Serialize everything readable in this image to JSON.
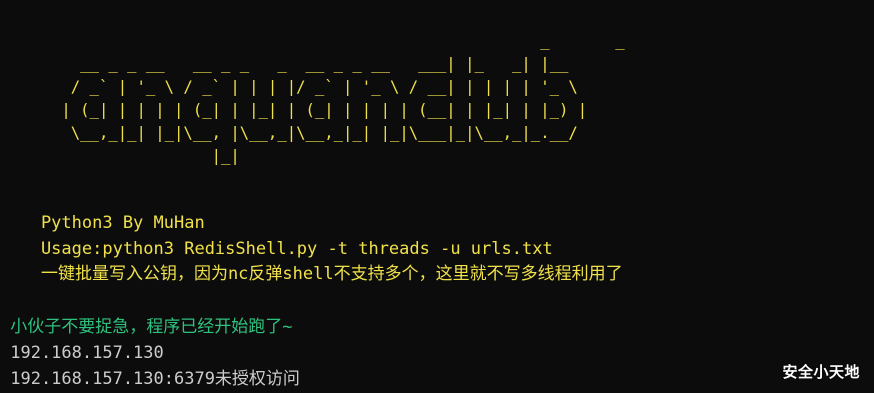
{
  "banner": {
    "art": "                                                    _       _\n   __ _ _ __   __ _ _   _  __ _ _ __   ___| |_   _| |__\n  / _` | '_ \\ / _` | | | |/ _` | '_ \\ / __| | | | | '_ \\\n | (_| | | | | (_| | |_| | (_| | | | | (__| | |_| | |_) |\n  \\__,_|_| |_|\\__, |\\__,_|\\__,_|_| |_|\\___|_|\\__,_|_.__/\n                 |_|"
  },
  "info": {
    "author": "    Python3 By MuHan",
    "usage": "    Usage:python3 RedisShell.py -t threads -u urls.txt",
    "note": "    一键批量写入公钥，因为nc反弹shell不支持多个，这里就不写多线程利用了"
  },
  "output": {
    "status": " 小伙子不要捉急，程序已经开始跑了~",
    "lines": [
      " 192.168.157.130",
      " 192.168.157.130:6379未授权访问"
    ]
  },
  "watermark": "安全小天地",
  "colors": {
    "background": "#0c0c0c",
    "yellow": "#f0e14a",
    "green": "#2ec27e",
    "white": "#cccccc"
  }
}
